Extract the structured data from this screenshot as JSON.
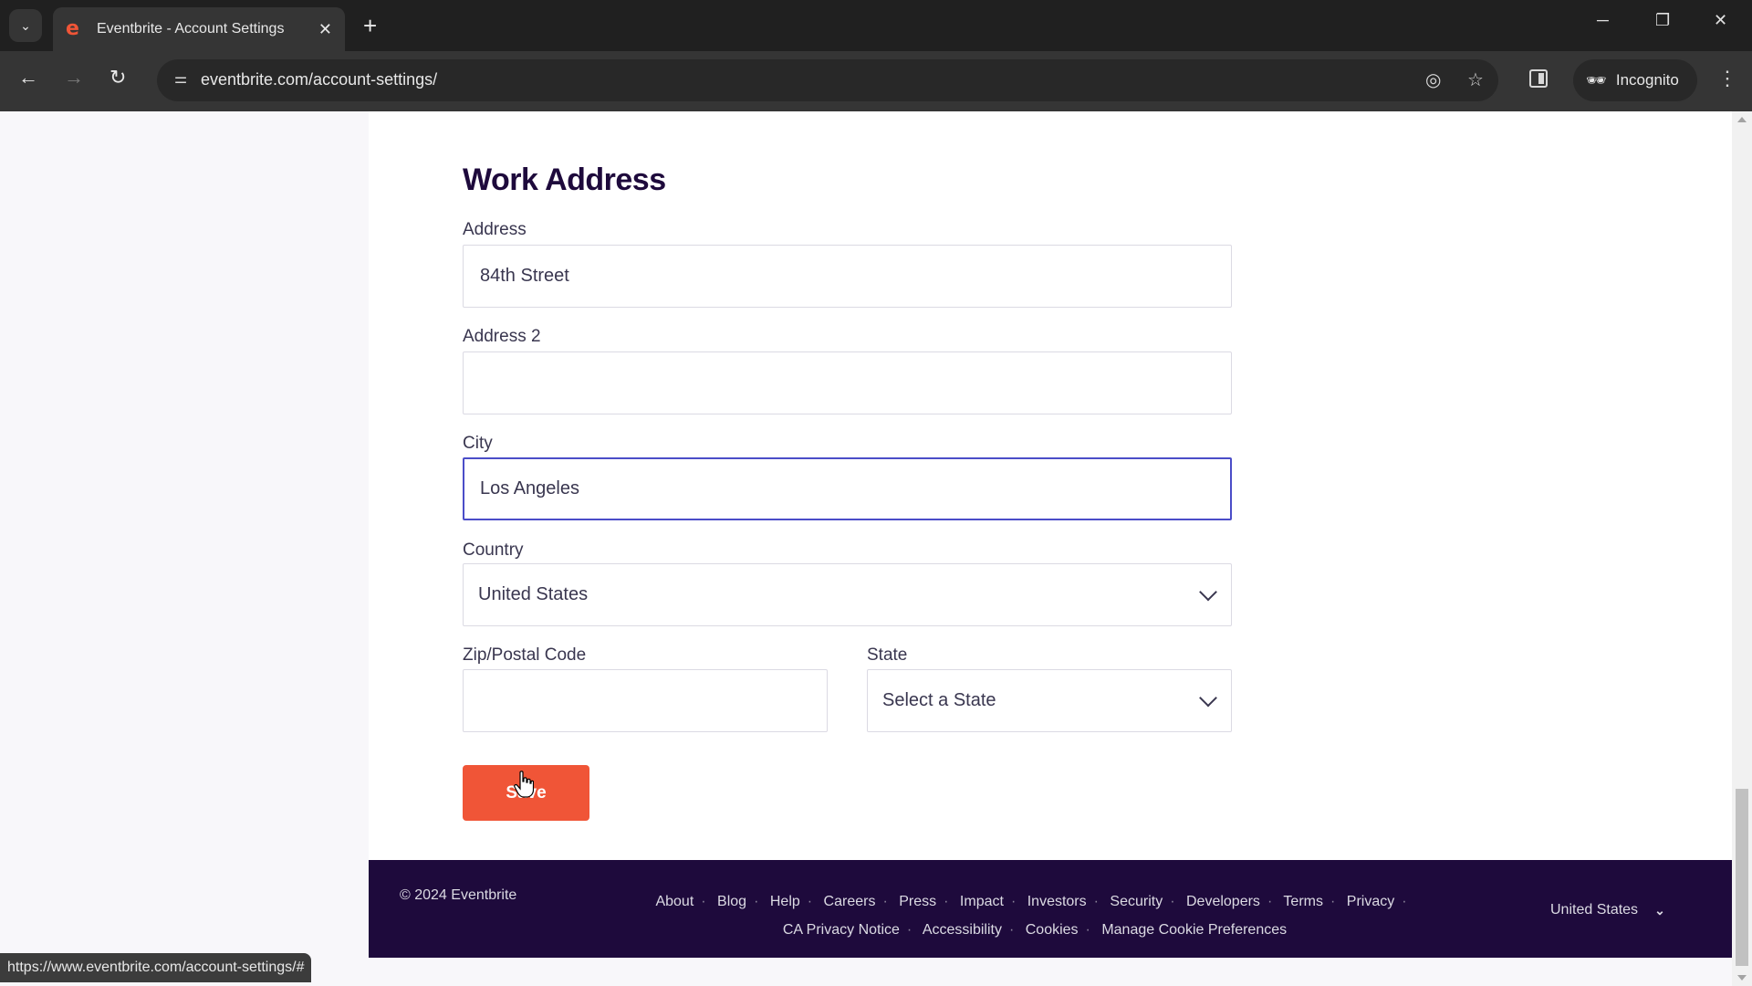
{
  "browser": {
    "tab": {
      "title": "Eventbrite - Account Settings",
      "favicon": "e"
    },
    "url": "eventbrite.com/account-settings/",
    "incognito_label": "Incognito",
    "status_url": "https://www.eventbrite.com/account-settings/#"
  },
  "icons": {
    "tab_list": "⌄",
    "close": "✕",
    "new_tab": "+",
    "minimize": "─",
    "restore": "❐",
    "window_close": "✕",
    "back": "←",
    "forward": "→",
    "reload": "↻",
    "site_info": "⚌",
    "eye_off": "◎",
    "star": "☆",
    "incognito": "🕶",
    "menu": "⋮"
  },
  "form": {
    "heading": "Work Address",
    "address": {
      "label": "Address",
      "value": "84th Street"
    },
    "address2": {
      "label": "Address 2",
      "value": ""
    },
    "city": {
      "label": "City",
      "value": "Los Angeles"
    },
    "country": {
      "label": "Country",
      "value": "United States"
    },
    "zip": {
      "label": "Zip/Postal Code",
      "value": ""
    },
    "state": {
      "label": "State",
      "value": "Select a State"
    },
    "save_label": "Save"
  },
  "footer": {
    "copyright": "© 2024 Eventbrite",
    "links": [
      "About",
      "Blog",
      "Help",
      "Careers",
      "Press",
      "Impact",
      "Investors",
      "Security",
      "Developers",
      "Terms",
      "Privacy",
      "CA Privacy Notice",
      "Accessibility",
      "Cookies",
      "Manage Cookie Preferences"
    ],
    "country": "United States"
  },
  "colors": {
    "brand_orange": "#f05537",
    "footer_bg": "#1e0a3c",
    "focus_border": "#4b4dc8"
  }
}
